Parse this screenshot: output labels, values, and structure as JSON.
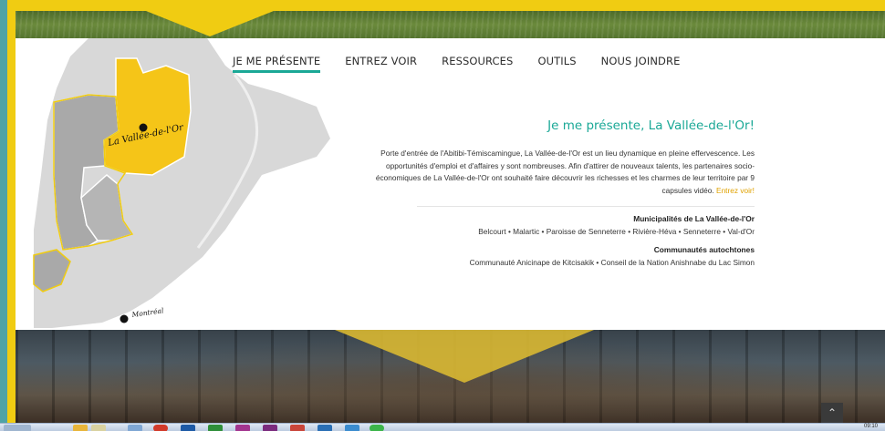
{
  "nav": {
    "items": [
      {
        "label": "JE ME PRÉSENTE",
        "active": true
      },
      {
        "label": "ENTREZ VOIR",
        "active": false
      },
      {
        "label": "RESSOURCES",
        "active": false
      },
      {
        "label": "OUTILS",
        "active": false
      },
      {
        "label": "NOUS JOINDRE",
        "active": false
      }
    ]
  },
  "map": {
    "region_label": "La Vallée-de-l'Or",
    "city_label": "Montréal"
  },
  "intro": {
    "title": "Je me présente, La Vallée-de-l'Or!",
    "text": "Porte d'entrée de l'Abitibi-Témiscamingue, La Vallée-de-l'Or est un lieu dynamique en pleine effervescence. Les opportunités d'emploi et d'affaires y sont nombreuses. Afin d'attirer de nouveaux talents, les partenaires socio-économiques de La Vallée-de-l'Or ont souhaité faire découvrir les richesses et les charmes de leur territoire par 9 capsules vidéo.",
    "link": "Entrez voir!"
  },
  "municipalities": {
    "heading": "Municipalités de La Vallée-de-l'Or",
    "list": "Belcourt • Malartic • Paroisse de Senneterre • Rivière-Héva • Senneterre • Val-d'Or"
  },
  "communities": {
    "heading": "Communautés autochtones",
    "list": "Communauté Anicinape de Kitcisakik • Conseil de la Nation Anishnabe du Lac Simon"
  },
  "scroll_top_icon": "chevron-up-icon",
  "colors": {
    "accent": "#1aa896",
    "frame": "#f0cc12",
    "link": "#e0a200"
  },
  "taskbar": {
    "time": "09:10"
  }
}
